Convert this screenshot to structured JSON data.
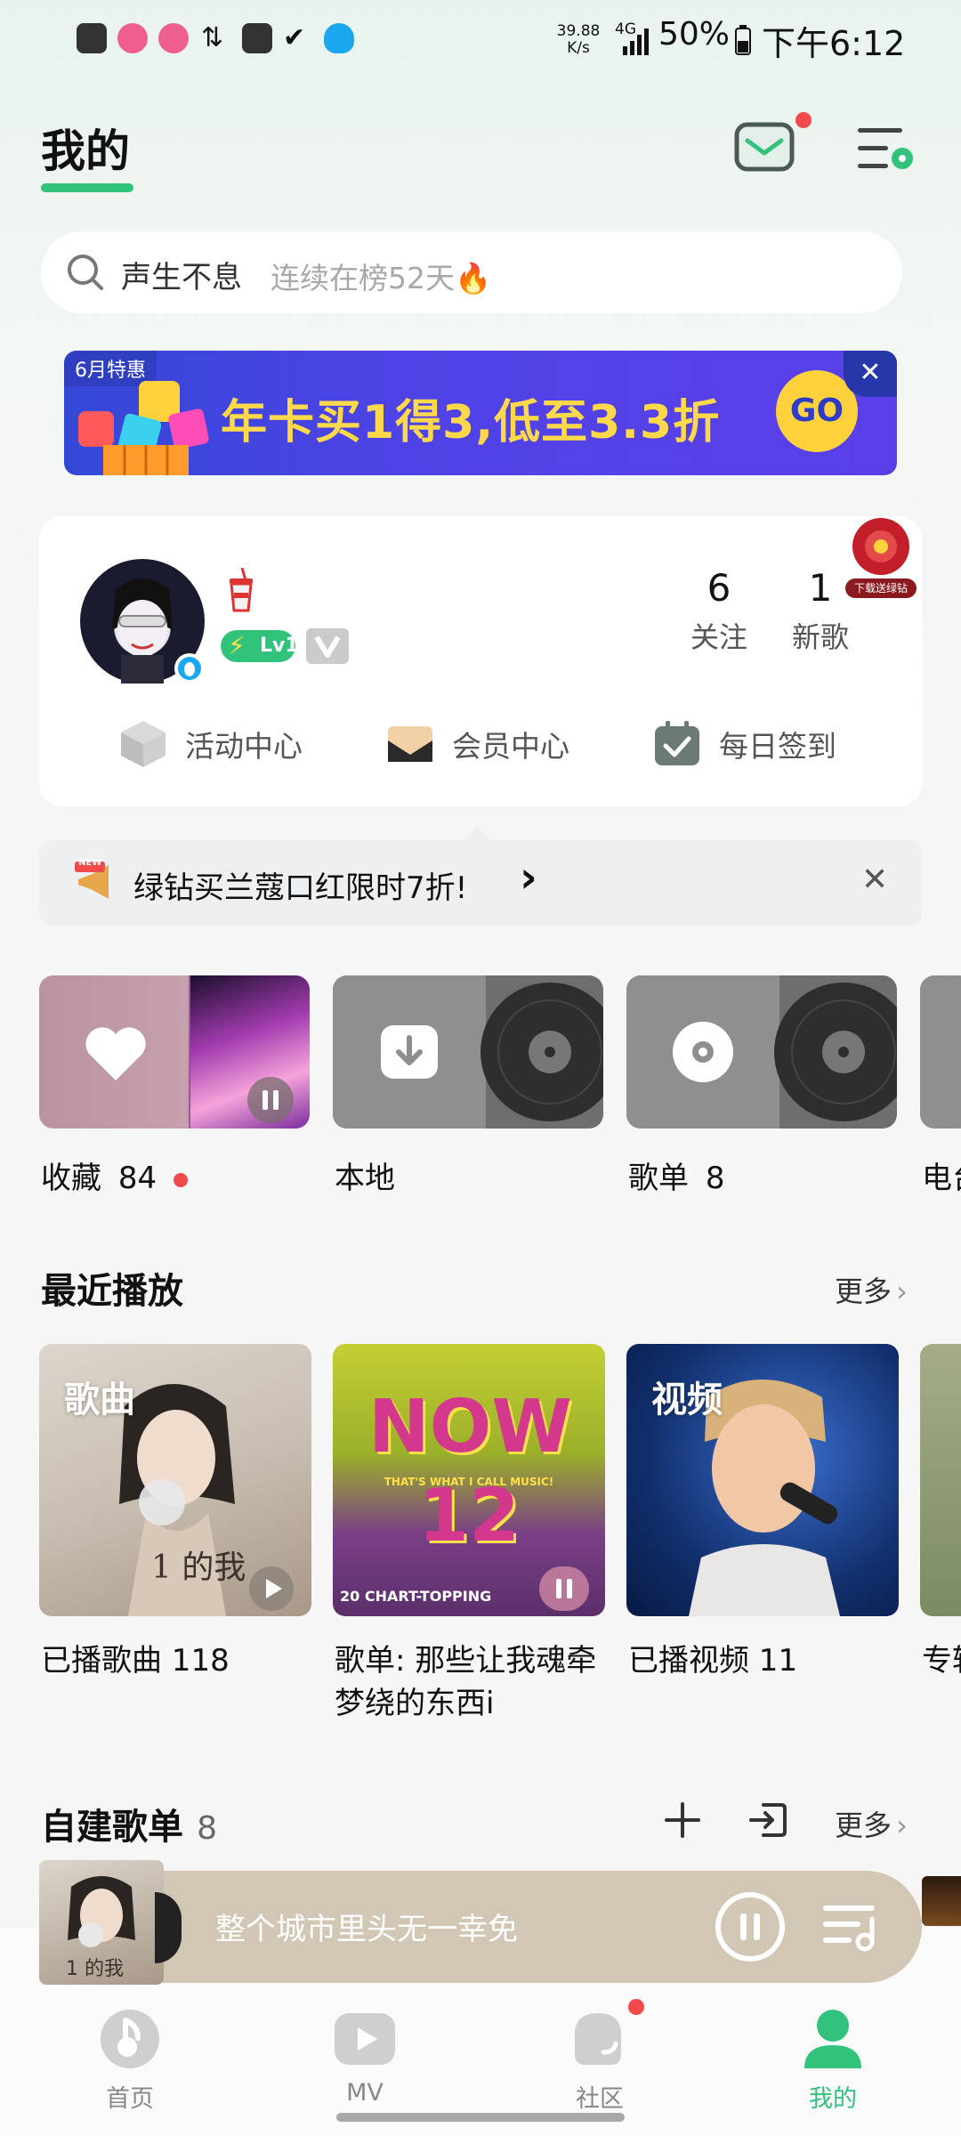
{
  "status_bar": {
    "net_speed_value": "39.88",
    "net_speed_unit": "K/s",
    "network": "4G",
    "battery": "50%",
    "time": "下午6:12"
  },
  "header": {
    "title": "我的"
  },
  "search": {
    "query": "声生不息",
    "hint": "连续在榜52天🔥"
  },
  "banner": {
    "tag": "6月特惠",
    "text": "年卡买1得3,低至3.3折",
    "go_label": "GO",
    "close_label": "✕"
  },
  "profile": {
    "level_badge": "Lv1",
    "corner_badge_text": "下载送绿钻",
    "stats": [
      {
        "num": "6",
        "label": "关注"
      },
      {
        "num": "1",
        "label": "新歌"
      }
    ],
    "actions": [
      {
        "label": "活动中心",
        "icon": "cube-icon"
      },
      {
        "label": "会员中心",
        "icon": "envelope-icon"
      },
      {
        "label": "每日签到",
        "icon": "calendar-check-icon"
      }
    ]
  },
  "notice": {
    "badge": "NEW",
    "text": "绿钻买兰蔻口红限时7折!",
    "arrow": "›",
    "close": "✕"
  },
  "quick_tiles": [
    {
      "label": "收藏",
      "count": "84"
    },
    {
      "label": "本地",
      "count": ""
    },
    {
      "label": "歌单",
      "count": "8"
    },
    {
      "label": "电台",
      "count": ""
    }
  ],
  "recent": {
    "title": "最近播放",
    "more": "更多",
    "cards": [
      {
        "tag": "歌曲",
        "label": "已播歌曲 118",
        "cover_text": "1 的我"
      },
      {
        "tag": "",
        "label": "歌单: 那些让我魂牵梦绕的东西i",
        "cover_text": "NOW 12",
        "cover_sub": "THAT'S WHAT I CALL MUSIC!",
        "cover_bottom": "20 CHART-TOPPING"
      },
      {
        "tag": "视频",
        "label": "已播视频 11"
      },
      {
        "tag": "",
        "label": "专辑"
      }
    ]
  },
  "playlists": {
    "title": "自建歌单",
    "count": "8",
    "more": "更多"
  },
  "player": {
    "title": "整个城市里头无一幸免",
    "cover_text": "1 的我"
  },
  "nav": [
    {
      "label": "首页",
      "active": false
    },
    {
      "label": "MV",
      "active": false
    },
    {
      "label": "社区",
      "active": false
    },
    {
      "label": "我的",
      "active": true
    }
  ],
  "colors": {
    "accent": "#31c27c",
    "badge_red": "#f24a4a"
  }
}
